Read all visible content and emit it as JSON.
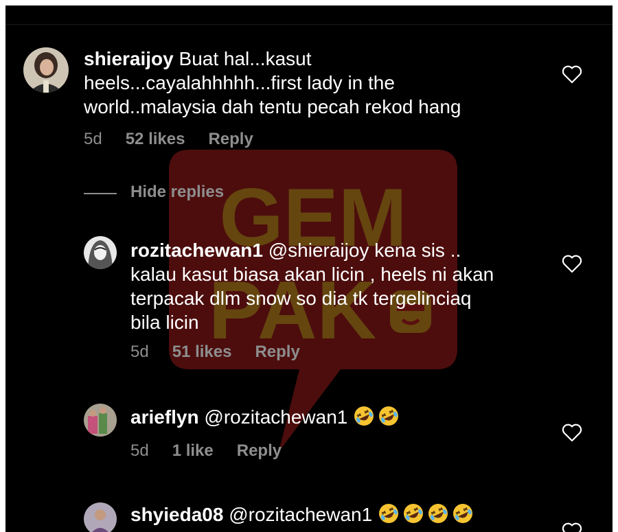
{
  "watermark": {
    "line1": "GEM",
    "line2": "PAK",
    "bg": "#6b1414",
    "fg": "#8a6b12"
  },
  "actions": {
    "hide_replies": "Hide replies"
  },
  "comments": [
    {
      "username": "shieraijoy",
      "line1": "Buat hal...kasut",
      "line2": "heels...cayalahhhhh...first lady in the",
      "line3": "world..malaysia dah tentu pecah rekod hang",
      "time": "5d",
      "likes": "52 likes",
      "reply": "Reply"
    },
    {
      "username": "rozitachewan1",
      "line1": "@shieraijoy kena sis ..",
      "line2": "kalau kasut biasa akan licin , heels ni akan",
      "line3": "terpacak dlm snow so dia tk tergelinciaq",
      "line4": "bila licin",
      "time": "5d",
      "likes": "51 likes",
      "reply": "Reply"
    },
    {
      "username": "arieflyn",
      "mention": "@rozitachewan1",
      "emoji": "rolling-on-floor-laughing",
      "emoji_count": 2,
      "time": "5d",
      "likes": "1 like",
      "reply": "Reply"
    },
    {
      "username": "shyieda08",
      "mention": "@rozitachewan1",
      "emoji": "rolling-on-floor-laughing",
      "emoji_count": 4
    }
  ],
  "colors": {
    "background": "#000000",
    "text": "#ffffff",
    "muted": "#8e8e8e"
  }
}
